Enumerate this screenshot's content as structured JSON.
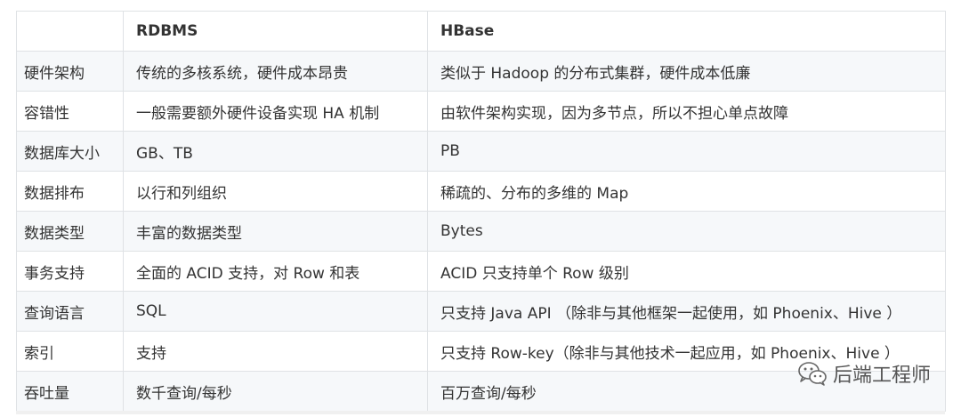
{
  "table": {
    "headers": [
      "",
      "RDBMS",
      "HBase"
    ],
    "rows": [
      [
        "硬件架构",
        "传统的多核系统，硬件成本昂贵",
        "类似于 Hadoop 的分布式集群，硬件成本低廉"
      ],
      [
        "容错性",
        "一般需要额外硬件设备实现 HA 机制",
        "由软件架构实现，因为多节点，所以不担心单点故障"
      ],
      [
        "数据库大小",
        "GB、TB",
        "PB"
      ],
      [
        "数据排布",
        "以行和列组织",
        "稀疏的、分布的多维的 Map"
      ],
      [
        "数据类型",
        "丰富的数据类型",
        "Bytes"
      ],
      [
        "事务支持",
        "全面的 ACID 支持，对 Row 和表",
        "ACID 只支持单个 Row 级别"
      ],
      [
        "查询语言",
        "SQL",
        "只支持 Java API （除非与其他框架一起使用，如 Phoenix、Hive ）"
      ],
      [
        "索引",
        "支持",
        "只支持 Row-key（除非与其他技术一起应用，如 Phoenix、Hive ）"
      ],
      [
        "吞吐量",
        "数千查询/每秒",
        "百万查询/每秒"
      ]
    ]
  },
  "watermark": {
    "text": "后端工程师",
    "icon": "wechat-icon",
    "color": "#555555"
  },
  "colors": {
    "border": "#dfe2e5",
    "stripe": "#f6f8fa",
    "text": "#333333"
  }
}
